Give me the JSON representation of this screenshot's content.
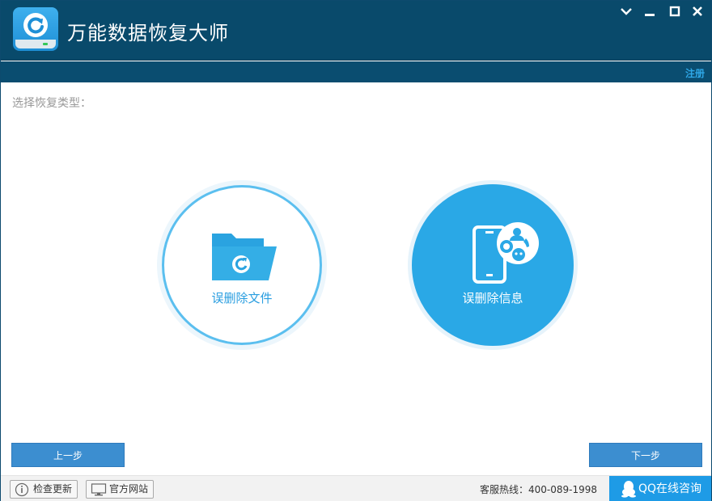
{
  "app": {
    "title": "万能数据恢复大师",
    "register_label": "注册"
  },
  "window_controls": {
    "icons": [
      "chevron-down-icon",
      "minimize-icon",
      "maximize-icon",
      "close-icon"
    ]
  },
  "main": {
    "prompt": "选择恢复类型：",
    "options": [
      {
        "label": "误删除文件",
        "icon": "folder-refresh-icon",
        "selected": false
      },
      {
        "label": "误删除信息",
        "icon": "phone-chat-icon",
        "selected": true
      }
    ],
    "prev_label": "上一步",
    "next_label": "下一步"
  },
  "statusbar": {
    "check_update_label": "检查更新",
    "official_site_label": "官方网站",
    "hotline": "客服热线：400-089-1998",
    "qq_label": "QQ在线咨询"
  },
  "colors": {
    "titlebar": "#094a6b",
    "accent": "#2aa8e6",
    "button": "#3c8ed0",
    "qq": "#1e9be6"
  }
}
